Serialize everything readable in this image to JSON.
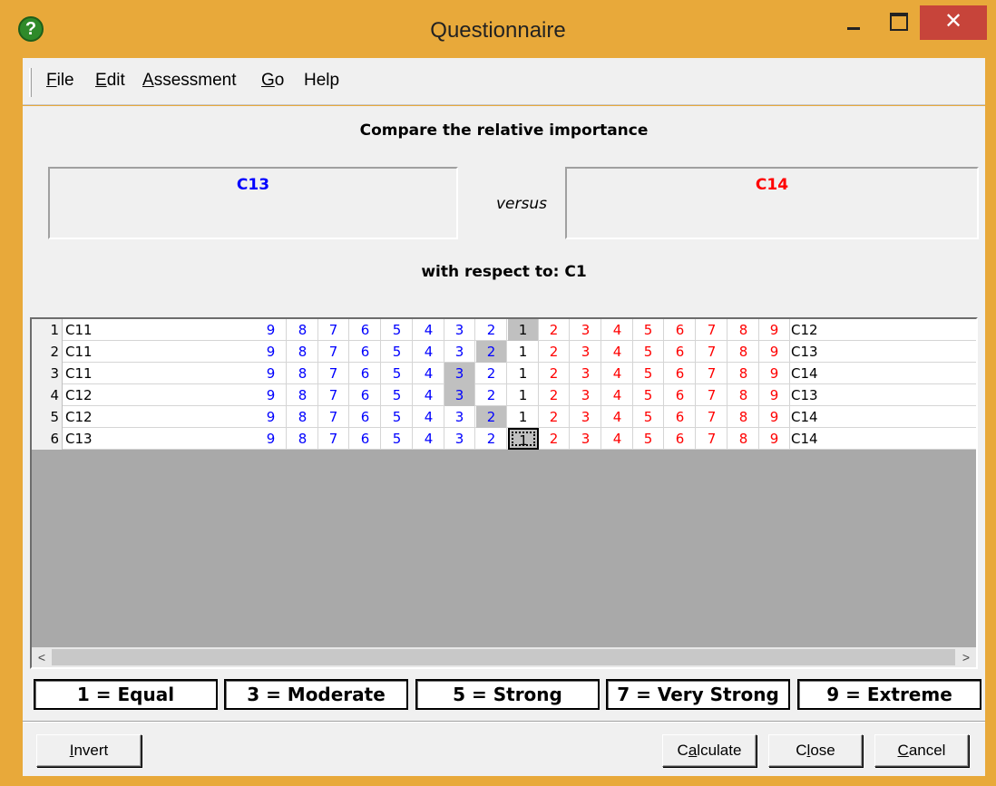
{
  "window": {
    "title": "Questionnaire",
    "close_glyph": "✕",
    "icon_glyph": "?"
  },
  "menu": [
    {
      "label": "File",
      "accel_index": 0
    },
    {
      "label": "Edit",
      "accel_index": 0
    },
    {
      "label": "Assessment",
      "accel_index": 0
    },
    {
      "label": "Go",
      "accel_index": 0
    },
    {
      "label": "Help",
      "accel_index": -1
    }
  ],
  "heading": "Compare the relative importance",
  "left_criterion": "C13",
  "versus": "versus",
  "right_criterion": "C14",
  "respect_to": "with respect to: C1",
  "scale_left": [
    "9",
    "8",
    "7",
    "6",
    "5",
    "4",
    "3",
    "2"
  ],
  "scale_center": "1",
  "scale_right": [
    "2",
    "3",
    "4",
    "5",
    "6",
    "7",
    "8",
    "9"
  ],
  "rows": [
    {
      "num": "1",
      "left": "C11",
      "right": "C12",
      "selected": "1",
      "side": "center",
      "focused": false
    },
    {
      "num": "2",
      "left": "C11",
      "right": "C13",
      "selected": "2",
      "side": "left",
      "focused": false
    },
    {
      "num": "3",
      "left": "C11",
      "right": "C14",
      "selected": "3",
      "side": "left",
      "focused": false
    },
    {
      "num": "4",
      "left": "C12",
      "right": "C13",
      "selected": "3",
      "side": "left",
      "focused": false
    },
    {
      "num": "5",
      "left": "C12",
      "right": "C14",
      "selected": "2",
      "side": "left",
      "focused": false
    },
    {
      "num": "6",
      "left": "C13",
      "right": "C14",
      "selected": "1",
      "side": "center",
      "focused": true
    }
  ],
  "scroll": {
    "left_arrow": "<",
    "right_arrow": ">"
  },
  "legend": [
    "1 = Equal",
    "3 = Moderate",
    "5 = Strong",
    "7 = Very Strong",
    "9 = Extreme"
  ],
  "buttons": {
    "invert": {
      "label": "Invert",
      "accel_index": 0
    },
    "calculate": {
      "label": "Calculate",
      "accel_index": 1
    },
    "close": {
      "label": "Close",
      "accel_index": 1
    },
    "cancel": {
      "label": "Cancel",
      "accel_index": 0
    }
  },
  "colors": {
    "left_criterion": "#0000ff",
    "right_criterion": "#ff0000",
    "titlebar": "#e8a93a",
    "close_button": "#c7443a"
  }
}
